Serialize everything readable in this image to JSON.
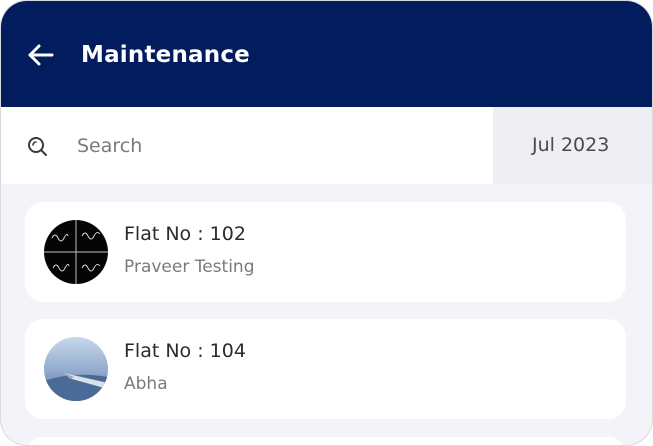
{
  "header": {
    "back_icon": "arrow-left-icon",
    "title": "Maintenance",
    "background": "#021c5d"
  },
  "search": {
    "icon": "search-icon",
    "placeholder": "Search",
    "value": ""
  },
  "month_selector": {
    "label": "Jul 2023"
  },
  "flats": [
    {
      "flat_label": "Flat No : 102",
      "resident": "Praveer Testing",
      "avatar": "signature-collage-avatar"
    },
    {
      "flat_label": "Flat No : 104",
      "resident": "Abha",
      "avatar": "airplane-wing-sky-avatar"
    }
  ]
}
